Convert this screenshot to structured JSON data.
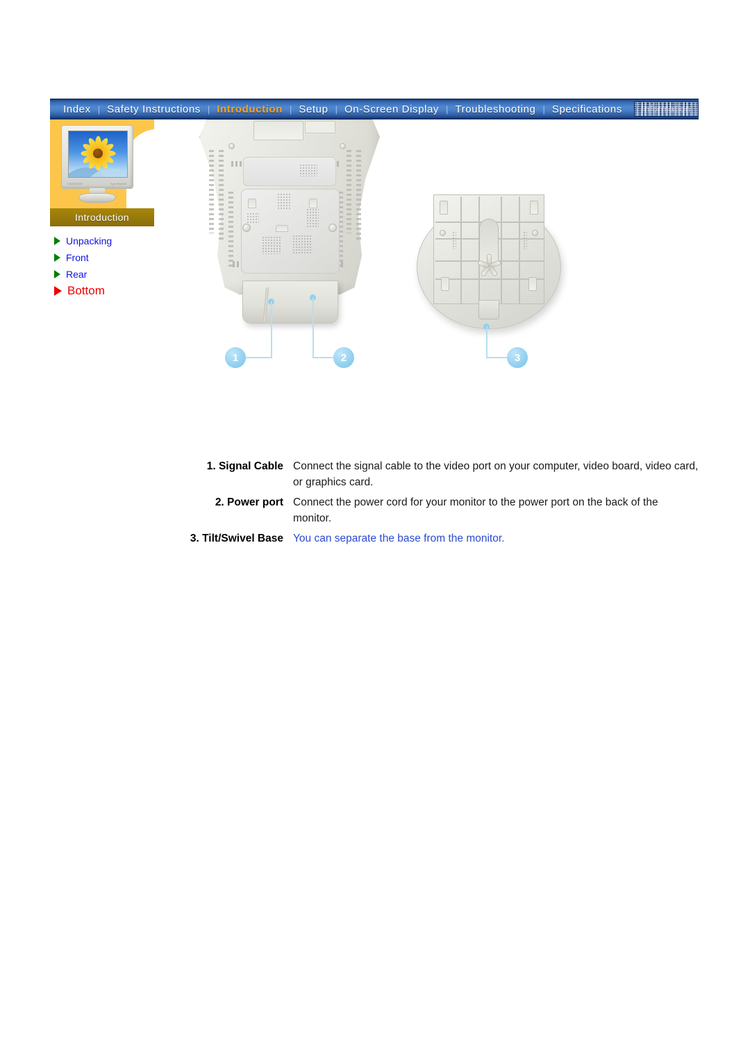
{
  "nav": {
    "items": [
      {
        "label": "Index",
        "active": false
      },
      {
        "label": "Safety Instructions",
        "active": false
      },
      {
        "label": "Introduction",
        "active": true
      },
      {
        "label": "Setup",
        "active": false
      },
      {
        "label": "On-Screen Display",
        "active": false
      },
      {
        "label": "Troubleshooting",
        "active": false
      },
      {
        "label": "Specifications",
        "active": false
      }
    ],
    "scrambled_item": "Information"
  },
  "sidebar": {
    "section_title": "Introduction",
    "thumbnail_alt": "monitor-sunflower-thumbnail",
    "items": [
      {
        "label": "Unpacking",
        "current": false
      },
      {
        "label": "Front",
        "current": false
      },
      {
        "label": "Rear",
        "current": false
      },
      {
        "label": "Bottom",
        "current": true
      }
    ]
  },
  "figure": {
    "alt": "monitor-bottom-view-and-tilt-swivel-base",
    "callouts": [
      {
        "number": "1"
      },
      {
        "number": "2"
      },
      {
        "number": "3"
      }
    ]
  },
  "spec": {
    "rows": [
      {
        "term": "1. Signal Cable",
        "desc": "Connect the signal cable to the video port on your computer, video board, video card, or graphics card.",
        "is_link": false
      },
      {
        "term": "2. Power port",
        "desc": "Connect the power cord for your monitor to the power port on the back of the monitor.",
        "is_link": false
      },
      {
        "term": "3. Tilt/Swivel Base",
        "desc": "You can separate the base from the monitor.",
        "is_link": true
      }
    ]
  },
  "colors": {
    "nav_blue": "#3568b4",
    "nav_active_text": "#ffa31a",
    "sidebar_orange": "#fdc64a",
    "sidebar_label_gold": "#96780a",
    "link_blue": "#1111dd",
    "current_red": "#ee0000",
    "callout_blue": "#8ccdee",
    "desc_link_blue": "#2a4bd0"
  }
}
